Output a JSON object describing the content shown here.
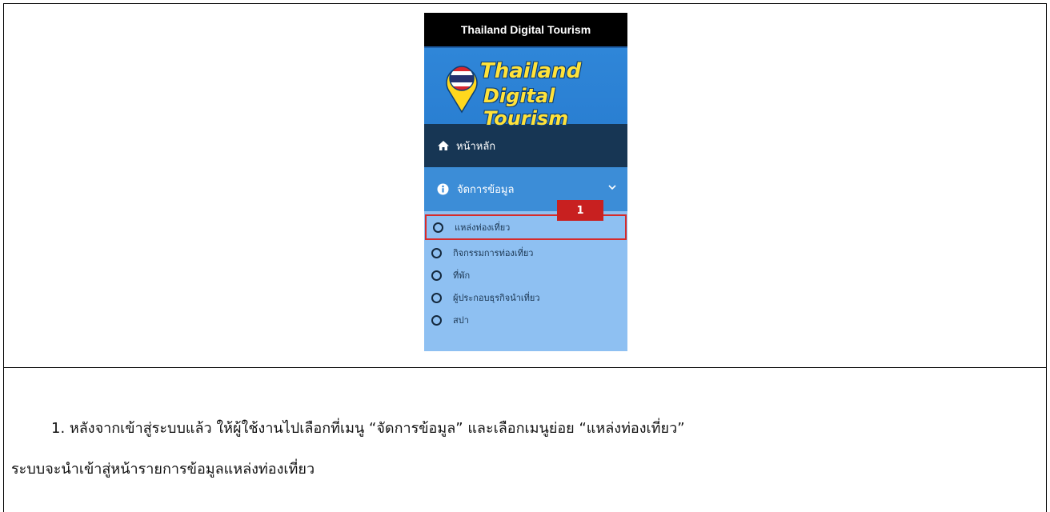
{
  "sidebar": {
    "app_title": "Thailand Digital Tourism",
    "logo": {
      "line1": "Thailand",
      "line2": "Digital Tourism"
    },
    "nav": {
      "home": {
        "label": "หน้าหลัก",
        "icon": "home-icon"
      },
      "manage_data": {
        "label": "จัดการข้อมูล",
        "icon": "info-circle-icon",
        "expand_icon": "chevron-down-icon"
      }
    },
    "submenu": [
      {
        "label": "แหล่งท่องเที่ยว",
        "icon": "circle-icon",
        "highlighted": true
      },
      {
        "label": "กิจกรรมการท่องเที่ยว",
        "icon": "circle-icon"
      },
      {
        "label": "ที่พัก",
        "icon": "circle-icon"
      },
      {
        "label": "ผู้ประกอบธุรกิจนำเที่ยว",
        "icon": "circle-icon"
      },
      {
        "label": "สปา",
        "icon": "circle-icon"
      }
    ],
    "step_badge": "1"
  },
  "instructions": {
    "line1": "1. หลังจากเข้าสู่ระบบแล้ว ให้ผู้ใช้งานไปเลือกที่เมนู “จัดการข้อมูล” และเลือกเมนูย่อย “แหล่งท่องเที่ยว”",
    "line2": "ระบบจะนำเข้าสู่หน้ารายการข้อมูลแหล่งท่องเที่ยว"
  },
  "colors": {
    "title_bar": "#000000",
    "logo_bg": "#2f86d8",
    "home_bg": "#173654",
    "manage_bg": "#3c8dd7",
    "submenu_bg": "#8ec0f2",
    "highlight": "#d62b2b",
    "logo_text": "#ffe23a"
  }
}
